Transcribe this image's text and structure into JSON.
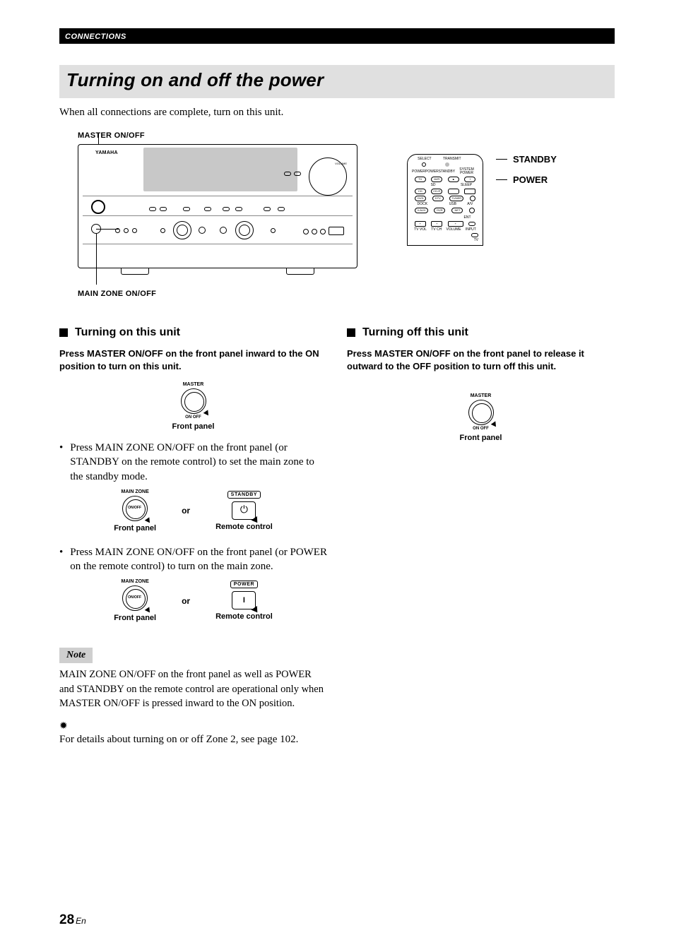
{
  "running_head": "CONNECTIONS",
  "title": "Turning on and off the power",
  "intro": "When all connections are complete, turn on this unit.",
  "fig": {
    "master_label": "MASTER ON/OFF",
    "mainzone_label": "MAIN ZONE ON/OFF",
    "panel_logo": "YAMAHA",
    "vol_label": "VOLUME"
  },
  "remote_callouts": {
    "standby": "STANDBY",
    "power": "POWER"
  },
  "remote_legend": {
    "select": "SELECT",
    "transmit": "TRANSMIT",
    "power": "POWER",
    "standby": "STANDBY",
    "systempower": "SYSTEM POWER",
    "tv": "TV",
    "avr": "AVR",
    "up": "▲",
    "sd": "SD",
    "sleep": "SLEEP",
    "cd": "CD",
    "cdr": "CD-R",
    "dvd": "DVD",
    "dtv": "DTV",
    "tuner": "TUNER",
    "dock": "DOCK",
    "usb": "USB",
    "av": "A/V",
    "vaux": "V-AUX",
    "dvr": "DVR",
    "net": "NET",
    "plus": "+",
    "tvvol": "TV VOL",
    "tvch": "TV CH",
    "volume": "VOLUME",
    "ent": "ENT",
    "input": "INPUT",
    "tvtext": "TV"
  },
  "left": {
    "heading": "Turning on this unit",
    "lead": "Press MASTER ON/OFF on the front panel inward to the ON position to turn on this unit.",
    "master_knob_label": "MASTER",
    "onoff": "ON    OFF",
    "frontpanel": "Front panel",
    "mainzone": "MAIN ZONE",
    "onoff_small": "ON/OFF",
    "or": "or",
    "bullet1": "Press MAIN ZONE ON/OFF on the front panel (or STANDBY on the remote control) to set the main zone to the standby mode.",
    "bullet2": "Press MAIN ZONE ON/OFF on the front panel (or POWER on the remote control) to turn on the main zone.",
    "remote_standby": "STANDBY",
    "remote_power": "POWER",
    "remote_caption": "Remote control"
  },
  "right": {
    "heading": "Turning off this unit",
    "lead": "Press MASTER ON/OFF on the front panel to release it outward to the OFF position to turn off this unit.",
    "master_knob_label": "MASTER",
    "onoff": "ON    OFF",
    "frontpanel": "Front panel"
  },
  "note_label": "Note",
  "note_text": "MAIN ZONE ON/OFF on the front panel as well as POWER and STANDBY on the remote control are operational only when MASTER ON/OFF is pressed inward to the ON position.",
  "tip": "For details about turning on or off Zone 2, see page 102.",
  "page_number": "28",
  "page_lang": "En"
}
